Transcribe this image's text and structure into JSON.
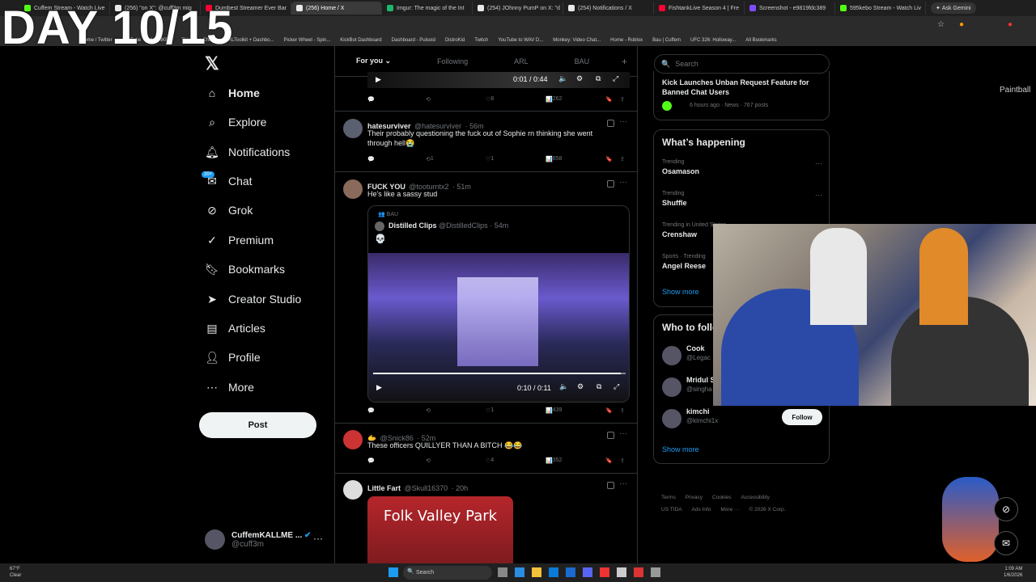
{
  "overlay": {
    "day_text": "DAY 10/15"
  },
  "browser": {
    "tabs": [
      {
        "label": "Cuffem Stream - Watch Live",
        "color": "#53fc18",
        "active": false
      },
      {
        "label": "(256) \"on X\": @cuff3m mig",
        "color": "#e7e9ea",
        "active": false
      },
      {
        "label": "Dumbest Streamer Ever Bar",
        "color": "#ff0033",
        "active": false
      },
      {
        "label": "(256) Home / X",
        "color": "#e7e9ea",
        "active": true
      },
      {
        "label": "Imgur: The magic of the Int",
        "color": "#1bb76e",
        "active": false
      },
      {
        "label": "(254) JOhnny PumP on X: \"d",
        "color": "#e7e9ea",
        "active": false
      },
      {
        "label": "(254) Notifications / X",
        "color": "#e7e9ea",
        "active": false
      },
      {
        "label": "FishtankLive Season 4 | Fre",
        "color": "#ff0033",
        "active": false
      },
      {
        "label": "Screenshot - e9819fdc389",
        "color": "#7c4dff",
        "active": false
      },
      {
        "label": "595kebo Stream - Watch Liv",
        "color": "#53fc18",
        "active": false
      }
    ],
    "ask_gemini": "Ask Gemini",
    "bookmarks": [
      "Home / Twitter",
      "YouTube",
      "MONKEY",
      "TV Video Chat...",
      "IRLToolkit + Dashbo...",
      "Picker Wheel - Spin...",
      "KickBot Dashboard",
      "Dashboard - Pulsoid",
      "DistroKid",
      "Twitch",
      "YouTube to WAV D...",
      "Monkey: Video Chat...",
      "Home - Roblox",
      "Bau | Cuffem",
      "UFC 326: Holloway...",
      "All Bookmarks"
    ]
  },
  "nav": {
    "logo": "𝕏",
    "items": [
      {
        "label": "Home",
        "icon": "home-icon"
      },
      {
        "label": "Explore",
        "icon": "search-icon"
      },
      {
        "label": "Notifications",
        "icon": "bell-icon"
      },
      {
        "label": "Chat",
        "icon": "chat-icon"
      },
      {
        "label": "Grok",
        "icon": "grok-icon"
      },
      {
        "label": "Premium",
        "icon": "premium-icon"
      },
      {
        "label": "Bookmarks",
        "icon": "bookmark-icon"
      },
      {
        "label": "Creator Studio",
        "icon": "rocket-icon"
      },
      {
        "label": "Articles",
        "icon": "article-icon"
      },
      {
        "label": "Profile",
        "icon": "person-icon"
      },
      {
        "label": "More",
        "icon": "more-circle-icon"
      }
    ],
    "chat_badge": "20+",
    "post_button": "Post",
    "account": {
      "name": "CuffemKALLME ...",
      "handle": "@cuff3m",
      "more": "···"
    }
  },
  "feed": {
    "tabs": [
      "For you",
      "Following",
      "ARL",
      "BAU"
    ],
    "plus": "+",
    "top_video_time": "0:01 / 0:44",
    "top_actions": {
      "likes": "8",
      "views": "262"
    },
    "posts": [
      {
        "name": "hatesurviver",
        "handle": "@hatesurviver",
        "time": "· 56m",
        "text": "Their probably questioning the fuck out of Sophie rn thinking she went through hell😭",
        "retweets": "1",
        "likes": "1",
        "views": "858"
      },
      {
        "name": "FUCK YOU",
        "handle": "@tooturntx2",
        "time": "· 51m",
        "text": "He's like a sassy stud",
        "quote": {
          "community": "BAU",
          "name": "Distilled Clips",
          "handle": "@DistilledClips",
          "time": "· 54m",
          "text": "💀",
          "video_time": "0:10 / 0:11"
        },
        "likes": "1",
        "views": "439"
      },
      {
        "name": "🫱",
        "handle": "@Snick86",
        "time": "· 52m",
        "text": "These officers QUILLYER THAN A BITCH 😂😂",
        "likes": "4",
        "views": "352"
      },
      {
        "name": "Little Fart",
        "handle": "@Skull16370",
        "time": "· 20h",
        "media_text": "Folk Valley Park"
      }
    ]
  },
  "sidebar": {
    "search_placeholder": "Search",
    "news": {
      "headline": "Kick Launches Unban Request Feature for Banned Chat Users",
      "meta": "6 hours ago · News · 767 posts"
    },
    "happening": {
      "title": "What’s happening",
      "trends": [
        {
          "meta": "Trending",
          "topic": "Osamason"
        },
        {
          "meta": "Trending",
          "topic": "Shuffle"
        },
        {
          "meta": "Trending in United States",
          "topic": "Crenshaw"
        },
        {
          "meta": "Sports · Trending",
          "topic": "Angel Reese"
        }
      ],
      "show_more": "Show more"
    },
    "who_to_follow": {
      "title": "Who to follow",
      "users": [
        {
          "name": "Cook",
          "handle": "@Legac"
        },
        {
          "name": "Mridul S",
          "handle": "@singha"
        },
        {
          "name": "kimchi",
          "handle": "@kimchi1x",
          "follow": "Follow"
        }
      ],
      "show_more": "Show more"
    },
    "footer": {
      "line1": [
        "Terms",
        "Privacy",
        "Cookies",
        "Accessibility"
      ],
      "line2": [
        "US TIDA",
        "Ads Info",
        "More ···",
        "© 2026 X Corp."
      ]
    },
    "edge_label": "Paintball"
  },
  "taskbar": {
    "weather_temp": "67°F",
    "weather_desc": "Clear",
    "search": "Search",
    "time": "1:09 AM",
    "date": "1/6/2026"
  },
  "colors": {
    "accent": "#1d9bf0",
    "background": "#000000",
    "border": "#2f3336",
    "muted": "#71767b"
  }
}
